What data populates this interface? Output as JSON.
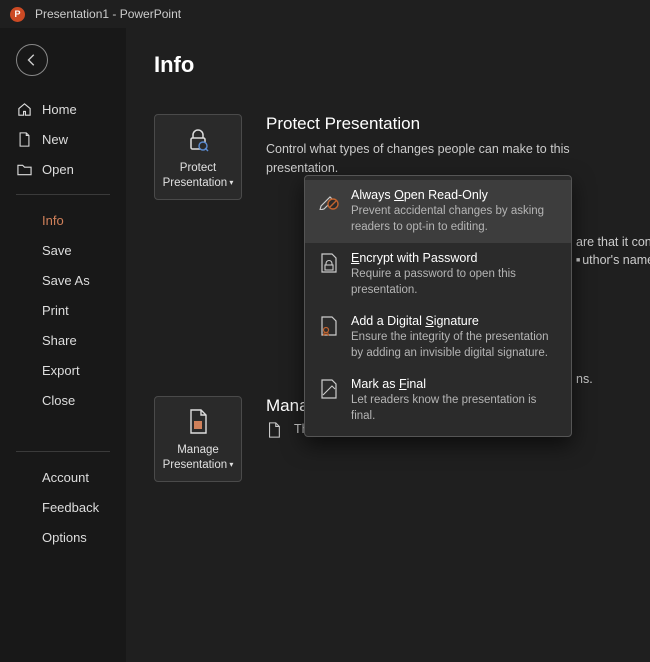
{
  "titlebar": {
    "title": "Presentation1  -  PowerPoint"
  },
  "sidebar": {
    "top": [
      {
        "label": "Home",
        "icon": "home"
      },
      {
        "label": "New",
        "icon": "doc"
      },
      {
        "label": "Open",
        "icon": "folder"
      }
    ],
    "middle": [
      {
        "label": "Info",
        "active": true
      },
      {
        "label": "Save"
      },
      {
        "label": "Save As"
      },
      {
        "label": "Print"
      },
      {
        "label": "Share"
      },
      {
        "label": "Export"
      },
      {
        "label": "Close"
      }
    ],
    "bottom": [
      {
        "label": "Account"
      },
      {
        "label": "Feedback"
      },
      {
        "label": "Options"
      }
    ]
  },
  "page": {
    "title": "Info",
    "protect": {
      "button": "Protect Presentation",
      "heading": "Protect Presentation",
      "desc": "Control what types of changes people can make to this presentation."
    },
    "manage": {
      "button": "Manage Presentation",
      "heading": "Manage Presentation",
      "no_changes": "There are no unsaved changes."
    },
    "behind": {
      "f1": "are that it contains:",
      "f2": "uthor's name",
      "f3": "ns."
    }
  },
  "menu": {
    "items": [
      {
        "title_pre": "Always ",
        "title_ul": "O",
        "title_post": "pen Read-Only",
        "desc": "Prevent accidental changes by asking readers to opt-in to editing.",
        "icon": "pen-prohibit",
        "hover": true
      },
      {
        "title_ul": "E",
        "title_post": "ncrypt with Password",
        "desc": "Require a password to open this presentation.",
        "icon": "lock-doc"
      },
      {
        "title_pre": "Add a Digital ",
        "title_ul": "S",
        "title_post": "ignature",
        "desc": "Ensure the integrity of the presentation by adding an invisible digital signature.",
        "icon": "ribbon-doc"
      },
      {
        "title_pre": "Mark as ",
        "title_ul": "F",
        "title_post": "inal",
        "desc": "Let readers know the presentation is final.",
        "icon": "final-doc"
      }
    ]
  }
}
